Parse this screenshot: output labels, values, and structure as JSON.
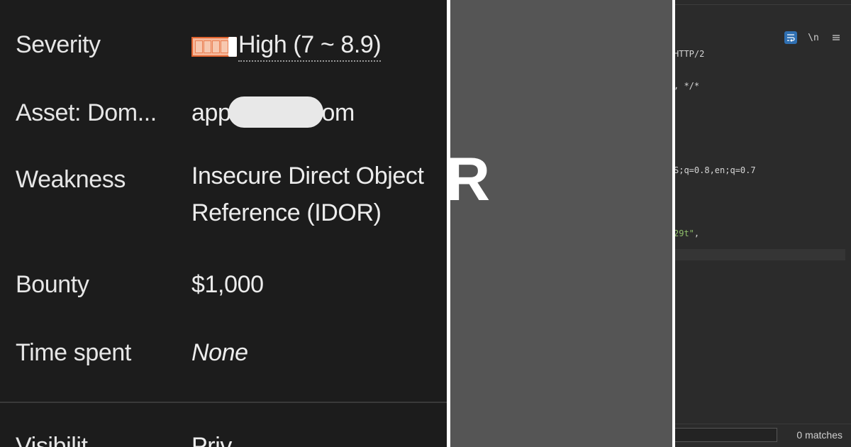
{
  "report": {
    "severity": {
      "label": "Severity",
      "value": "High (7 ~ 8.9)",
      "bar_color": "#e0632f"
    },
    "asset": {
      "label": "Asset: Dom...",
      "value_prefix": "app",
      "value_suffix": "om"
    },
    "weakness": {
      "label": "Weakness",
      "value_line1": "Insecure Direct Object",
      "value_line2": "Reference (IDOR)"
    },
    "bounty": {
      "label": "Bounty",
      "value": "$1,000"
    },
    "time_spent": {
      "label": "Time spent",
      "value": "None"
    },
    "visibility": {
      "label": "Visibilit",
      "value": "Priv"
    }
  },
  "overlay": {
    "edge_glyph": "R"
  },
  "request_viewer": {
    "toolbar": {
      "wrap_icon": "word-wrap-icon",
      "newline_label": "\\n",
      "menu_icon": "hamburger-menu-icon"
    },
    "code_lines": [
      {
        "text": "HTTP/2",
        "style": "plain"
      },
      {
        "text": ", */*",
        "style": "plain"
      },
      {
        "text": "S;q=0.8,en;q=0.7",
        "style": "plain"
      },
      {
        "text": "29t\"",
        "style": "string",
        "suffix": ","
      }
    ],
    "search": {
      "placeholder": "",
      "matches": "0 matches"
    }
  },
  "colors": {
    "accent_blue": "#2f6fb1",
    "string_green": "#8fbf6a",
    "severity_orange": "#e0632f"
  }
}
